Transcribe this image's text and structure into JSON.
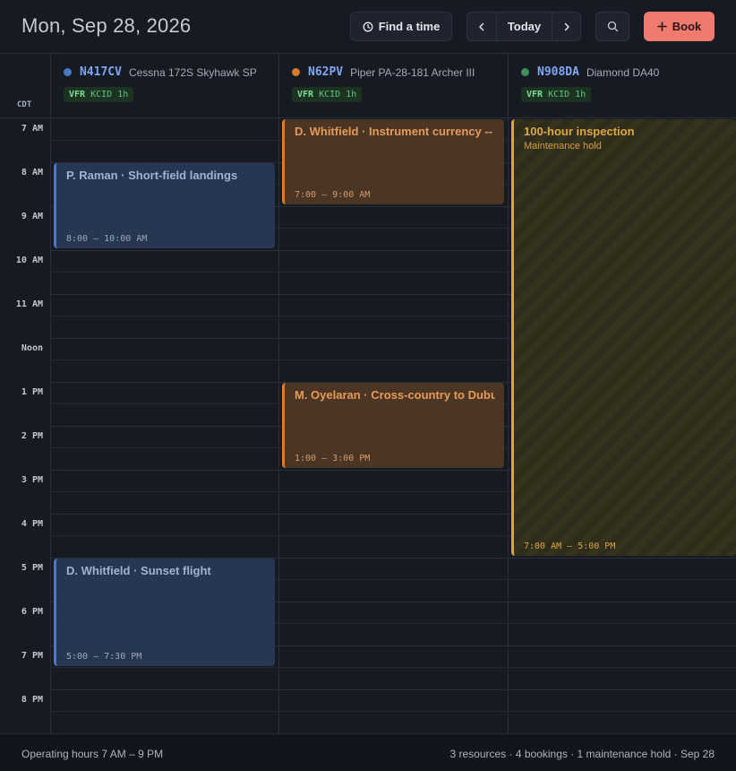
{
  "header": {
    "date_title": "Mon, Sep 28, 2026",
    "find_time_label": "Find a time",
    "today_label": "Today",
    "book_label": "Book"
  },
  "timezone": "CDT",
  "resources": [
    {
      "tail": "N417CV",
      "model": "Cessna 172S Skyhawk SP",
      "dot_color": "#4a78c4",
      "tail_color": "#7fa6f0",
      "badge_rules": "VFR",
      "badge_rest": "KCID 1h"
    },
    {
      "tail": "N62PV",
      "model": "Piper PA-28-181 Archer III",
      "dot_color": "#d67c2c",
      "tail_color": "#7fa6f0",
      "badge_rules": "VFR",
      "badge_rest": "KCID 1h"
    },
    {
      "tail": "N908DA",
      "model": "Diamond DA40",
      "dot_color": "#3f8f5c",
      "tail_color": "#7fa6f0",
      "badge_rules": "VFR",
      "badge_rest": "KCID 1h"
    }
  ],
  "hours": [
    "7 AM",
    "8 AM",
    "9 AM",
    "10 AM",
    "11 AM",
    "Noon",
    "1 PM",
    "2 PM",
    "3 PM",
    "4 PM",
    "5 PM",
    "6 PM",
    "7 PM",
    "8 PM"
  ],
  "events": [
    {
      "resource": 0,
      "title": "P. Raman · Short-field landings",
      "time": "8:00 – 10:00 AM",
      "kind": "blue",
      "start": 8,
      "end": 10
    },
    {
      "resource": 1,
      "title": "D. Whitfield · Instrument currency -- a",
      "time": "7:00 – 9:00 AM",
      "kind": "orange",
      "start": 7,
      "end": 9
    },
    {
      "resource": 2,
      "title": "100-hour inspection",
      "subtitle": "Maintenance hold",
      "time": "7:00 AM – 5:00 PM",
      "kind": "maint",
      "start": 7,
      "end": 17
    },
    {
      "resource": 1,
      "title": "M. Oyelaran · Cross-country to Dubuq",
      "time": "1:00 – 3:00 PM",
      "kind": "orange",
      "start": 13,
      "end": 15
    },
    {
      "resource": 0,
      "title": "D. Whitfield · Sunset flight",
      "time": "5:00 – 7:30 PM",
      "kind": "blue",
      "start": 17,
      "end": 19.5
    }
  ],
  "footer": {
    "left": "Operating hours 7 AM – 9 PM",
    "right": "3 resources · 4 bookings · 1 maintenance hold · Sep 28"
  }
}
